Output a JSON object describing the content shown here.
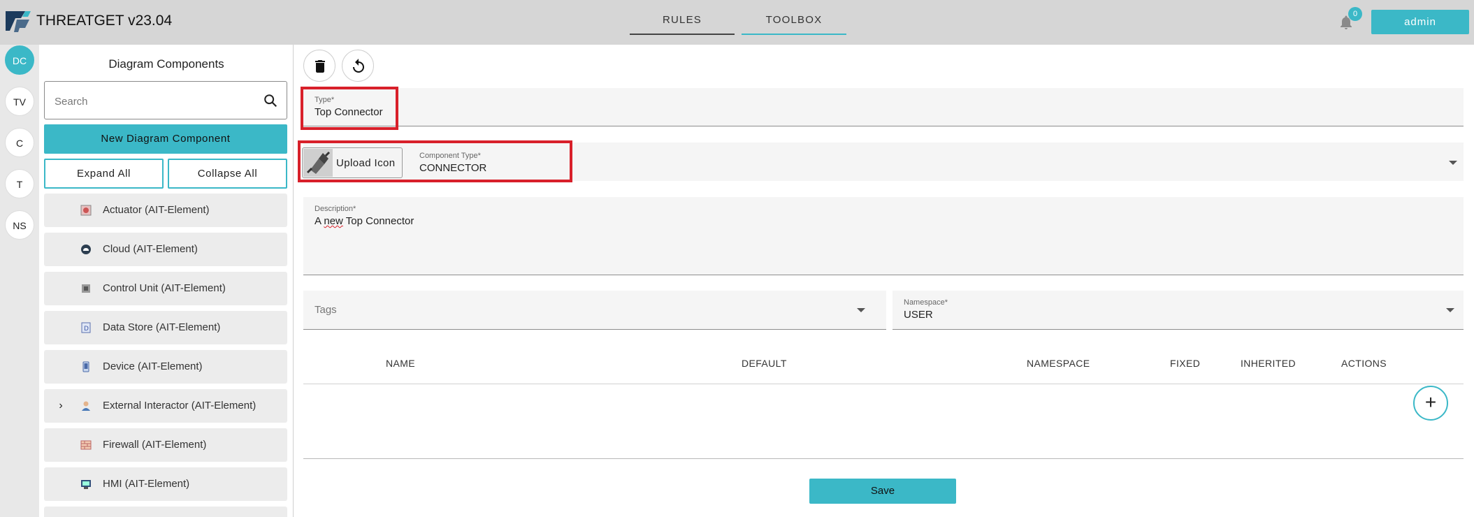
{
  "app": {
    "title": "THREATGET  v23.04",
    "nav_tabs": [
      {
        "label": "RULES"
      },
      {
        "label": "TOOLBOX"
      }
    ],
    "notification_count": "0",
    "user_label": "admin",
    "accent_color": "#3bb8c7",
    "highlight_color": "#d8202a"
  },
  "rail": {
    "items": [
      {
        "label": "DC"
      },
      {
        "label": "TV"
      },
      {
        "label": "C"
      },
      {
        "label": "T"
      },
      {
        "label": "NS"
      }
    ]
  },
  "sidebar": {
    "title": "Diagram Components",
    "search_placeholder": "Search",
    "new_button": "New Diagram Component",
    "expand_all": "Expand All",
    "collapse_all": "Collapse All",
    "items": [
      {
        "label": "Actuator (AIT-Element)",
        "icon": "actuator-icon"
      },
      {
        "label": "Cloud (AIT-Element)",
        "icon": "cloud-icon"
      },
      {
        "label": "Control Unit (AIT-Element)",
        "icon": "control-unit-icon"
      },
      {
        "label": "Data Store (AIT-Element)",
        "icon": "data-store-icon"
      },
      {
        "label": "Device (AIT-Element)",
        "icon": "device-icon"
      },
      {
        "label": "External Interactor (AIT-Element)",
        "icon": "person-icon",
        "expandable": true
      },
      {
        "label": "Firewall (AIT-Element)",
        "icon": "firewall-icon"
      },
      {
        "label": "HMI (AIT-Element)",
        "icon": "hmi-icon"
      }
    ]
  },
  "form": {
    "type": {
      "label": "Type*",
      "value": "Top Connector"
    },
    "upload_icon": "Upload Icon",
    "component_type": {
      "label": "Component Type*",
      "value": "CONNECTOR"
    },
    "description": {
      "label": "Description*",
      "value_pre": "A ",
      "value_misspelled": "new",
      "value_post": " Top Connector"
    },
    "tags": {
      "placeholder": "Tags"
    },
    "namespace": {
      "label": "Namespace*",
      "value": "USER"
    },
    "table_columns": [
      "NAME",
      "DEFAULT",
      "NAMESPACE",
      "FIXED",
      "INHERITED",
      "ACTIONS"
    ],
    "save_label": "Save"
  }
}
